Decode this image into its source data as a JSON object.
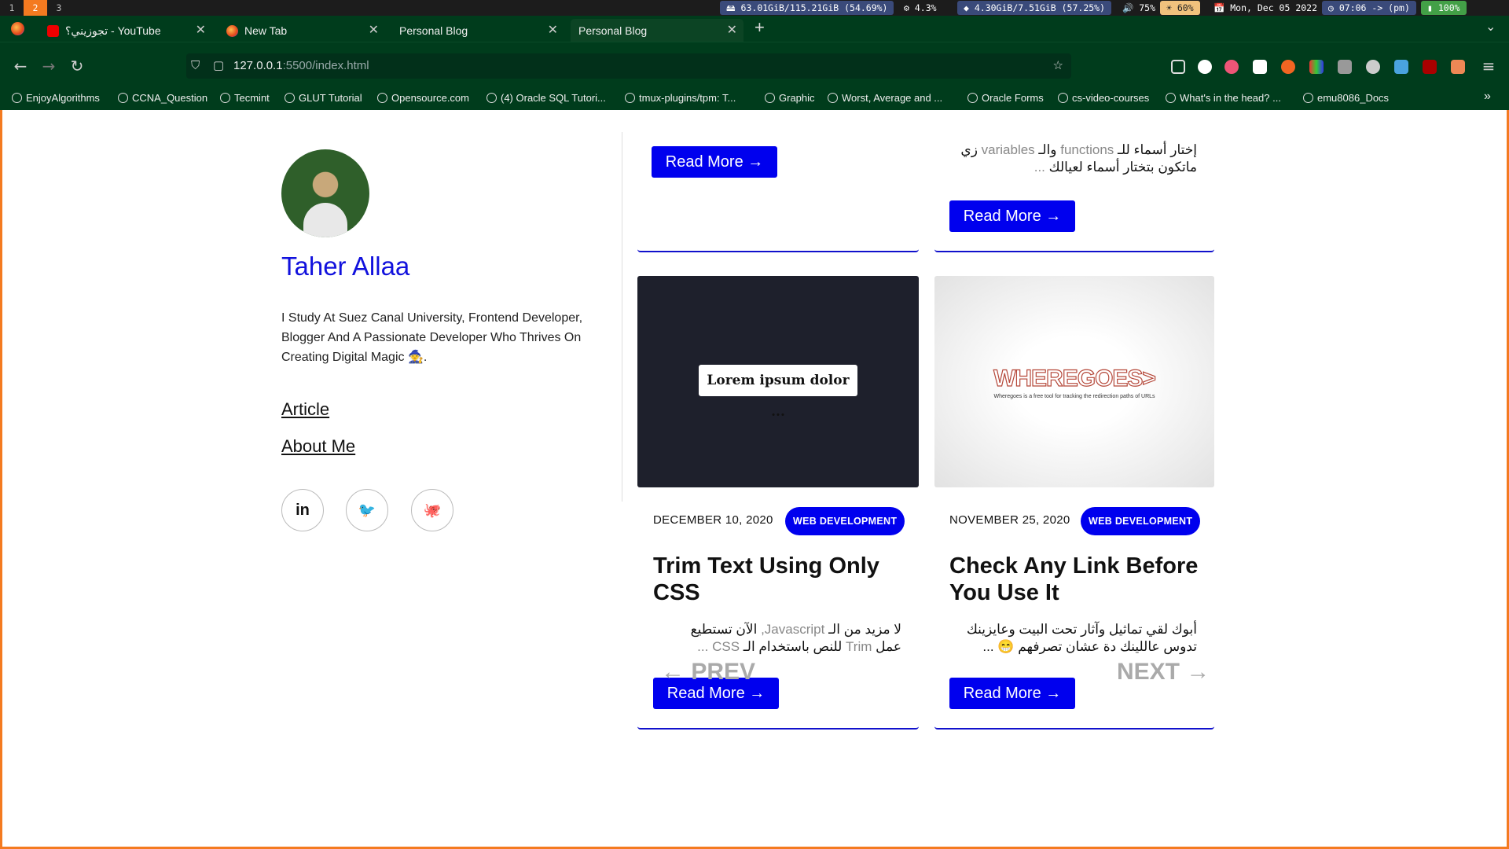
{
  "sysbar": {
    "workspaces": [
      "1",
      "2",
      "3"
    ],
    "disk": "63.01GiB/115.21GiB (54.69%)",
    "cpu": "4.3%",
    "mem": "4.30GiB/7.51GiB (57.25%)",
    "volume": "75%",
    "brightness": "60%",
    "date": "Mon, Dec 05 2022",
    "time": "07:06 -> (pm)",
    "battery": "100%"
  },
  "tabs": [
    {
      "label": "تجوزيني؟ - YouTube",
      "icon": "youtube-icon"
    },
    {
      "label": "New Tab",
      "icon": "firefox-icon"
    },
    {
      "label": "Personal Blog",
      "icon": ""
    },
    {
      "label": "Personal Blog",
      "icon": ""
    }
  ],
  "url": {
    "host": "127.0.0.1",
    "path": ":5500/index.html"
  },
  "bookmarks": [
    "EnjoyAlgorithms",
    "CCNA_Question",
    "Tecmint",
    "GLUT Tutorial",
    "Opensource.com",
    "(4) Oracle SQL Tutori...",
    "tmux-plugins/tpm: T...",
    "Graphic",
    "Worst, Average and ...",
    "Oracle Forms",
    "cs-video-courses",
    "What's in the head? ...",
    "emu8086_Docs"
  ],
  "profile": {
    "name": "Taher Allaa",
    "bio": "I Study At Suez Canal University, Frontend Developer, Blogger And A Passionate Developer Who Thrives On Creating Digital Magic 🧙.",
    "links": [
      "Article",
      "About Me"
    ],
    "social": [
      "in",
      "🐦",
      "🐙"
    ]
  },
  "top_cards": {
    "readmore": "Read More →",
    "right_excerpt_line1_a": "إختار أسماء للـ",
    "right_excerpt_line1_b": " functions ",
    "right_excerpt_line1_c": "والـ",
    "right_excerpt_line1_d": " variables ",
    "right_excerpt_line1_e": "زي",
    "right_excerpt_line2": "ماتكون بتختار أسماء لعيالك",
    "ellipsis": " ..."
  },
  "cards": [
    {
      "image_text": "Lorem ipsum dolor ...",
      "date": "DECEMBER 10, 2020",
      "tag": "WEB DEVELOPMENT",
      "title": "Trim Text Using Only CSS",
      "excerpt_l1_a": "لا مزيد من الـ",
      "excerpt_l1_b": " Javascript, ",
      "excerpt_l1_c": "الآن تستطيع",
      "excerpt_l2_a": "عمل",
      "excerpt_l2_b": " Trim ",
      "excerpt_l2_c": "للنص باستخدام الـ",
      "excerpt_l2_d": " CSS ...",
      "readmore": "Read More →"
    },
    {
      "image_title": "WHEREGOES>",
      "image_sub": "Wheregoes is a free tool for tracking the redirection paths of URLs",
      "date": "NOVEMBER 25, 2020",
      "tag": "WEB DEVELOPMENT",
      "title": "Check Any Link Before You Use It",
      "excerpt_l1": "أبوك لقي تماثيل وآثار تحت البيت وعايزينك",
      "excerpt_l2": "تدوس عاللينك دة عشان تصرفهم 😁 ...",
      "readmore": "Read More →"
    }
  ],
  "pager": {
    "prev": "← PREV",
    "next": "NEXT →"
  },
  "colors": {
    "accent": "#0000ee",
    "firefox_chrome": "#003c1c",
    "frame": "#f47a20"
  }
}
